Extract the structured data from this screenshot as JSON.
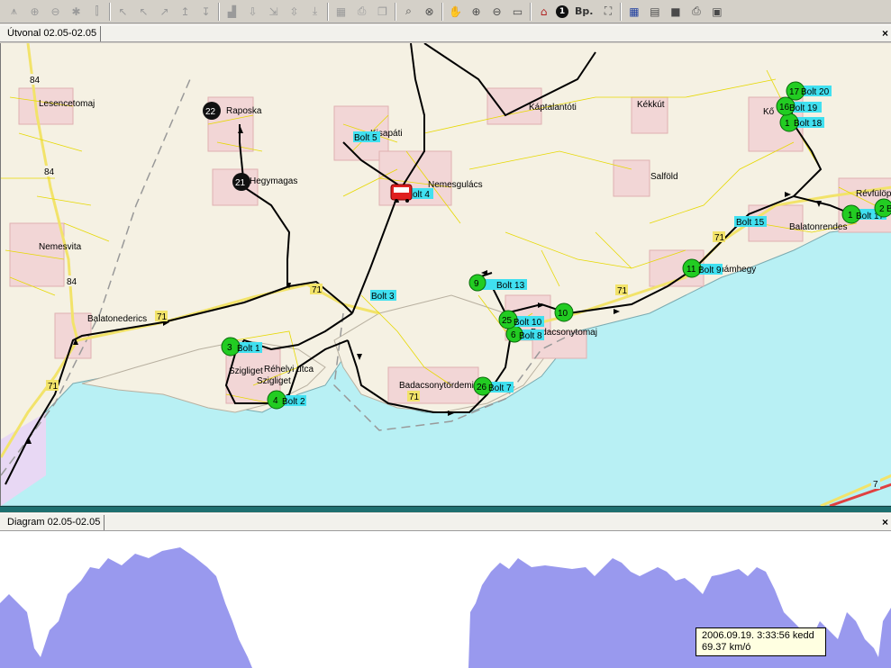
{
  "toolbar": {
    "buttons": [
      {
        "name": "zoom-extent-icon",
        "glyph": "⩚",
        "state": "disabled"
      },
      {
        "name": "zoom-in-icon",
        "glyph": "⊕",
        "state": "disabled"
      },
      {
        "name": "zoom-out-icon",
        "glyph": "⊖",
        "state": "disabled"
      },
      {
        "name": "zoom-reset-icon",
        "glyph": "✱",
        "state": "disabled"
      },
      {
        "name": "route-tool-icon",
        "glyph": "⫿",
        "state": "disabled"
      },
      {
        "sep": true
      },
      {
        "name": "pointer-icon",
        "glyph": "↖",
        "state": "disabled"
      },
      {
        "name": "pointer-add-icon",
        "glyph": "↖",
        "state": "disabled"
      },
      {
        "name": "pointer-move-icon",
        "glyph": "↗",
        "state": "disabled"
      },
      {
        "name": "pointer-edit-icon",
        "glyph": "↥",
        "state": "disabled"
      },
      {
        "name": "pointer-delete-icon",
        "glyph": "↧",
        "state": "disabled"
      },
      {
        "sep": true
      },
      {
        "name": "chart-icon",
        "glyph": "▟",
        "state": "disabled"
      },
      {
        "name": "download-icon",
        "glyph": "⇩",
        "state": "disabled"
      },
      {
        "name": "export-icon",
        "glyph": "⇲",
        "state": "disabled"
      },
      {
        "name": "import-icon",
        "glyph": "⇳",
        "state": "disabled"
      },
      {
        "name": "save-down-icon",
        "glyph": "⤓",
        "state": "disabled"
      },
      {
        "sep": true
      },
      {
        "name": "table-icon",
        "glyph": "▦",
        "state": "disabled"
      },
      {
        "name": "printer-icon",
        "glyph": "⎙",
        "state": "disabled"
      },
      {
        "name": "copy-icon",
        "glyph": "❐",
        "state": "disabled"
      },
      {
        "sep": true
      },
      {
        "name": "zoom-window-icon",
        "glyph": "⌕",
        "state": "active"
      },
      {
        "name": "zoom-fit-icon",
        "glyph": "⊗",
        "state": "active"
      },
      {
        "sep": true
      },
      {
        "name": "hand-pan-icon",
        "glyph": "✋",
        "state": "active"
      },
      {
        "name": "magnify-plus-icon",
        "glyph": "⊕",
        "state": "active"
      },
      {
        "name": "magnify-minus-icon",
        "glyph": "⊖",
        "state": "active"
      },
      {
        "name": "ruler-icon",
        "glyph": "▭",
        "state": "active"
      },
      {
        "sep": true
      },
      {
        "name": "home-icon",
        "glyph": "⌂",
        "state": "red"
      },
      {
        "name": "number-one-icon",
        "glyph": "1",
        "state": "round"
      },
      {
        "name": "budapest-label-icon",
        "glyph": "Bp.",
        "state": "text"
      },
      {
        "name": "fullscreen-icon",
        "glyph": "⛶",
        "state": "active"
      },
      {
        "sep": true
      },
      {
        "name": "grid-icon",
        "glyph": "▦",
        "state": "blue"
      },
      {
        "name": "layers-icon",
        "glyph": "▤",
        "state": "active"
      },
      {
        "name": "camera-icon",
        "glyph": "■",
        "state": "active"
      },
      {
        "name": "print-icon",
        "glyph": "⎙",
        "state": "active"
      },
      {
        "name": "clipboard-icon",
        "glyph": "▣",
        "state": "active"
      }
    ]
  },
  "map_pane": {
    "title": "Útvonal 02.05-02.05",
    "close": "×"
  },
  "diagram_pane": {
    "title": "Diagram 02.05-02.05",
    "close": "×"
  },
  "colors": {
    "land": "#f5f1e3",
    "water": "#b8f0f4",
    "forest": "#ece6c8",
    "village": "#f2d6d6",
    "road_main": "#f2e36a",
    "road_local": "#e6d800",
    "route": "#000000",
    "stop_green": "#22cc22",
    "label_bg": "#40e0f0",
    "chart_fill": "#9999ee",
    "divider": "#1d6f6f"
  },
  "map_labels": {
    "towns": [
      {
        "id": "lesencetomaj",
        "text": "Lesencetomaj"
      },
      {
        "id": "raposka",
        "text": "Raposka"
      },
      {
        "id": "hegymagas",
        "text": "Hegymagas"
      },
      {
        "id": "kisapati",
        "text": "Kisapáti"
      },
      {
        "id": "nemesgulacs",
        "text": "Nemesgulács"
      },
      {
        "id": "kaptalantoti",
        "text": "Káptalantóti"
      },
      {
        "id": "kekkut",
        "text": "Kékkút"
      },
      {
        "id": "salfold",
        "text": "Salföld"
      },
      {
        "id": "kovagoors",
        "text": "Kő"
      },
      {
        "id": "revfulop",
        "text": "Révfülöp"
      },
      {
        "id": "balatonrendes",
        "text": "Balatonrendes"
      },
      {
        "id": "nemesvita",
        "text": "Nemesvita"
      },
      {
        "id": "balatonederics",
        "text": "Balatonederics"
      },
      {
        "id": "szigliget1",
        "text": "Szigliget"
      },
      {
        "id": "szigliget2",
        "text": "Szigliget"
      },
      {
        "id": "rehelyi",
        "text": "Réhelyi utca"
      },
      {
        "id": "badacsonytordemic",
        "text": "Badacsonytördemic"
      },
      {
        "id": "badacsonytomaj",
        "text": "Badacsonytomaj"
      },
      {
        "id": "abrahamhegy",
        "text": "Ábrahámhegy"
      }
    ],
    "road_numbers": [
      {
        "id": "r84a",
        "text": "84"
      },
      {
        "id": "r84b",
        "text": "84"
      },
      {
        "id": "r84c",
        "text": "84"
      },
      {
        "id": "r71a",
        "text": "71"
      },
      {
        "id": "r71b",
        "text": "71"
      },
      {
        "id": "r71c",
        "text": "71"
      },
      {
        "id": "r71d",
        "text": "71"
      },
      {
        "id": "r71e",
        "text": "71"
      },
      {
        "id": "r71f",
        "text": "71"
      },
      {
        "id": "r7",
        "text": "7"
      }
    ]
  },
  "stops": [
    {
      "id": "s1",
      "num": "3",
      "label": "Bolt 1",
      "color": "green"
    },
    {
      "id": "s2",
      "num": "4",
      "label": "Bolt 2",
      "color": "green"
    },
    {
      "id": "s3",
      "num": "",
      "label": "Bolt 3",
      "color": "none"
    },
    {
      "id": "s4",
      "num": "",
      "label": "olt 4",
      "color": "bus"
    },
    {
      "id": "s5",
      "num": "",
      "label": "Bolt 5",
      "color": "none"
    },
    {
      "id": "s7",
      "num": "26",
      "label": "Bolt 7",
      "color": "green"
    },
    {
      "id": "s8",
      "num": "6",
      "label": "Bolt 8",
      "color": "green"
    },
    {
      "id": "s9",
      "num": "11",
      "label": "Bolt 9",
      "color": "green"
    },
    {
      "id": "s10",
      "num": "25",
      "label": "Bolt 10",
      "color": "green"
    },
    {
      "id": "s10b",
      "num": "10",
      "label": "",
      "color": "green"
    },
    {
      "id": "s13",
      "num": "9",
      "label": "Bolt 13",
      "color": "green"
    },
    {
      "id": "s15",
      "num": "",
      "label": "Bolt 15",
      "color": "none"
    },
    {
      "id": "s17",
      "num": "1",
      "label": "Bolt 17",
      "color": "green"
    },
    {
      "id": "s17b",
      "num": "2",
      "label": "B",
      "color": "green"
    },
    {
      "id": "s18",
      "num": "1",
      "label": "Bolt 18",
      "color": "green"
    },
    {
      "id": "s19",
      "num": "16",
      "label": "Bolt 19",
      "color": "green"
    },
    {
      "id": "s20",
      "num": "17",
      "label": "Bolt 20",
      "color": "green"
    },
    {
      "id": "s21",
      "num": "21",
      "label": "",
      "color": "black"
    },
    {
      "id": "s22",
      "num": "22",
      "label": "",
      "color": "black"
    }
  ],
  "tooltip": {
    "line1": "2006.09.19. 3:33:56 kedd",
    "line2": "69.37 km/ó"
  }
}
